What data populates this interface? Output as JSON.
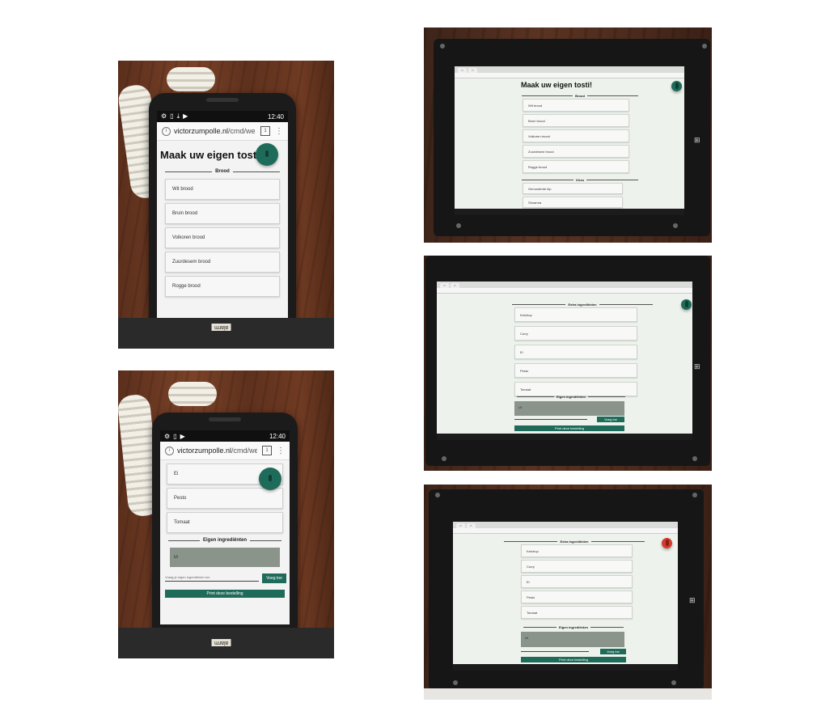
{
  "phone1": {
    "time": "12:40",
    "url_domain": "victorzumpolle.nl",
    "url_path": "/cmd/webde",
    "tab_count": "1",
    "title": "Maak uw eigen tosti!",
    "section": "Brood",
    "items": [
      "Wit brood",
      "Bruin brood",
      "Volkoren brood",
      "Zuurdesem brood",
      "Rogge brood"
    ],
    "badge": "alarm"
  },
  "phone2": {
    "time": "12:40",
    "url_domain": "victorzumpolle.nl",
    "url_path": "/cmd/webde",
    "tab_count": "1",
    "items": [
      "Ei",
      "Pesto",
      "Tomaat"
    ],
    "section": "Eigen ingrediënten",
    "eigen_value": "Ui",
    "input_placeholder": "Vraag je eigen ingrediënten toe",
    "add_button": "Voeg toe",
    "print_button": "Print deze bestelling",
    "badge": "alarm"
  },
  "tablet1": {
    "title": "Maak uw eigen tosti!",
    "section": "Brood",
    "items": [
      "Wit brood",
      "Bruin brood",
      "Volkoren brood",
      "Zuurdesem brood",
      "Rogge brood"
    ],
    "section2": "Vlees",
    "items2": [
      "Geroosterde kip",
      "Shoarma"
    ]
  },
  "tablet2": {
    "section": "Extra ingrediënten",
    "items": [
      "Ketchup",
      "Curry",
      "Ei",
      "Pesto",
      "Tomaat"
    ],
    "section2": "Eigen ingrediënten",
    "eigen_value": "Ui",
    "add_button": "Voeg toe",
    "print_button": "Print deze bestelling"
  },
  "tablet3": {
    "section": "Extra ingrediënten",
    "items": [
      "Ketchup",
      "Curry",
      "Ei",
      "Pesto",
      "Tomaat"
    ],
    "section2": "Eigen ingrediënten",
    "eigen_value": "Ui",
    "add_button": "Voeg toe",
    "print_button": "Print deze bestelling"
  },
  "colors": {
    "accent": "#1f6b5a",
    "mic_active": "#d43b2c",
    "wood": "#6b3a22"
  }
}
